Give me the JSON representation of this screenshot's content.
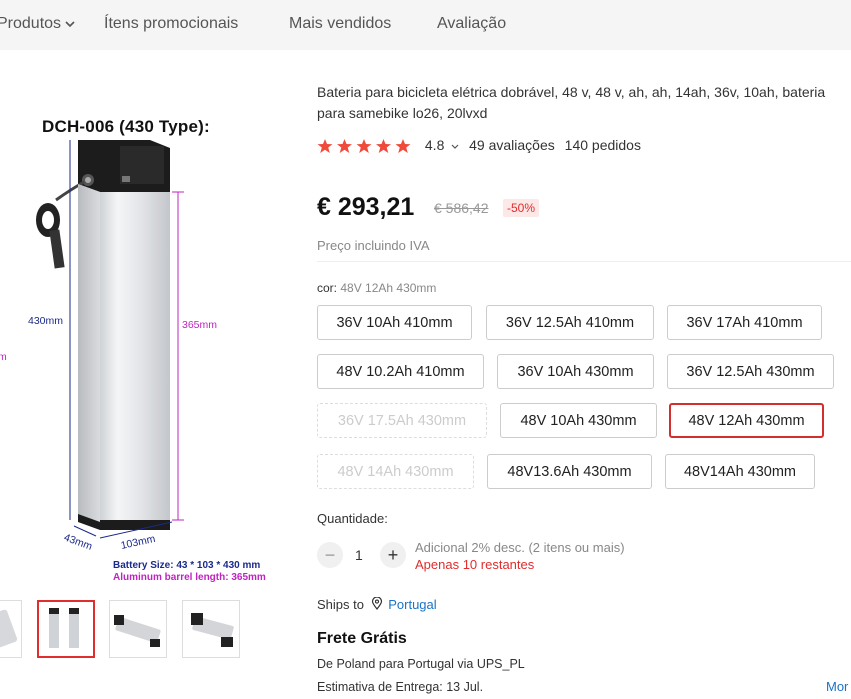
{
  "nav": {
    "items": [
      "Produtos",
      "Ítens promocionais",
      "Mais vendidos",
      "Avaliação"
    ]
  },
  "gallery": {
    "image_title": "DCH-006 (430 Type):",
    "dim_height": "430mm",
    "dim_barrel": "365mm",
    "dim_width": "103mm",
    "dim_depth": "43mm",
    "dim_left_cut": "m",
    "battery_size": "Battery Size:  43 * 103 * 430 mm",
    "barrel_length": "Aluminum barrel length: 365mm"
  },
  "product": {
    "title": "Bateria para bicicleta elétrica dobrável, 48 v, 48 v, ah, ah, 14ah, 36v, 10ah, bateria para samebike lo26, 20lvxd",
    "rating": "4.8",
    "reviews": "49 avaliações",
    "orders": "140 pedidos",
    "price": "€ 293,21",
    "old_price": "€ 586,42",
    "discount": "-50%",
    "vat": "Preço incluindo IVA",
    "color_label": "cor:",
    "color_value": "48V 12Ah 430mm",
    "options": [
      "36V 10Ah 410mm",
      "36V 12.5Ah 410mm",
      "36V 17Ah 410mm",
      "48V 10.2Ah 410mm",
      "36V 10Ah 430mm",
      "36V 12.5Ah 430mm",
      "36V 17.5Ah 430mm",
      "48V 10Ah 430mm",
      "48V 12Ah 430mm",
      "48V 14Ah 430mm",
      "48V13.6Ah 430mm",
      "48V14Ah 430mm"
    ]
  },
  "quantity": {
    "label": "Quantidade:",
    "minus": "−",
    "value": "1",
    "plus": "+",
    "note": "Adicional 2% desc. (2 itens ou mais)",
    "stock": "Apenas 10 restantes"
  },
  "shipping": {
    "ships_to": "Ships to",
    "location": "Portugal",
    "free": "Frete Grátis",
    "from_prefix": "De Poland para Portugal via UPS_PL",
    "estimate": "Estimativa de Entrega: 13 Jul.",
    "more": "Mor"
  },
  "colors": {
    "accent": "#e02d2d",
    "link": "#1a73c8",
    "star": "#f04a3a"
  }
}
